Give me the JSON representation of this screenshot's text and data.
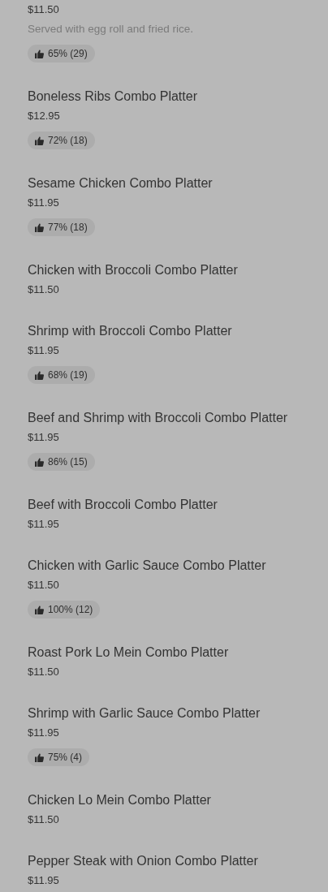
{
  "items": [
    {
      "price": "$11.50",
      "description": "Served with egg roll and fried rice.",
      "rating": "65% (29)"
    },
    {
      "name": "Boneless Ribs Combo Platter",
      "price": "$12.95",
      "rating": "72% (18)"
    },
    {
      "name": "Sesame Chicken Combo Platter",
      "price": "$11.95",
      "rating": "77% (18)"
    },
    {
      "name": "Chicken with Broccoli Combo Platter",
      "price": "$11.50"
    },
    {
      "name": "Shrimp with Broccoli Combo Platter",
      "price": "$11.95",
      "rating": "68% (19)"
    },
    {
      "name": "Beef and Shrimp with Broccoli Combo Platter",
      "price": "$11.95",
      "rating": "86% (15)"
    },
    {
      "name": "Beef with Broccoli Combo Platter",
      "price": "$11.95"
    },
    {
      "name": "Chicken with Garlic Sauce Combo Platter",
      "price": "$11.50",
      "rating": "100% (12)"
    },
    {
      "name": "Roast Pork Lo Mein Combo Platter",
      "price": "$11.50"
    },
    {
      "name": "Shrimp with Garlic Sauce Combo Platter",
      "price": "$11.95",
      "rating": "75% (4)"
    },
    {
      "name": "Chicken Lo Mein Combo Platter",
      "price": "$11.50"
    },
    {
      "name": "Pepper Steak with Onion Combo Platter",
      "price": "$11.95"
    }
  ]
}
